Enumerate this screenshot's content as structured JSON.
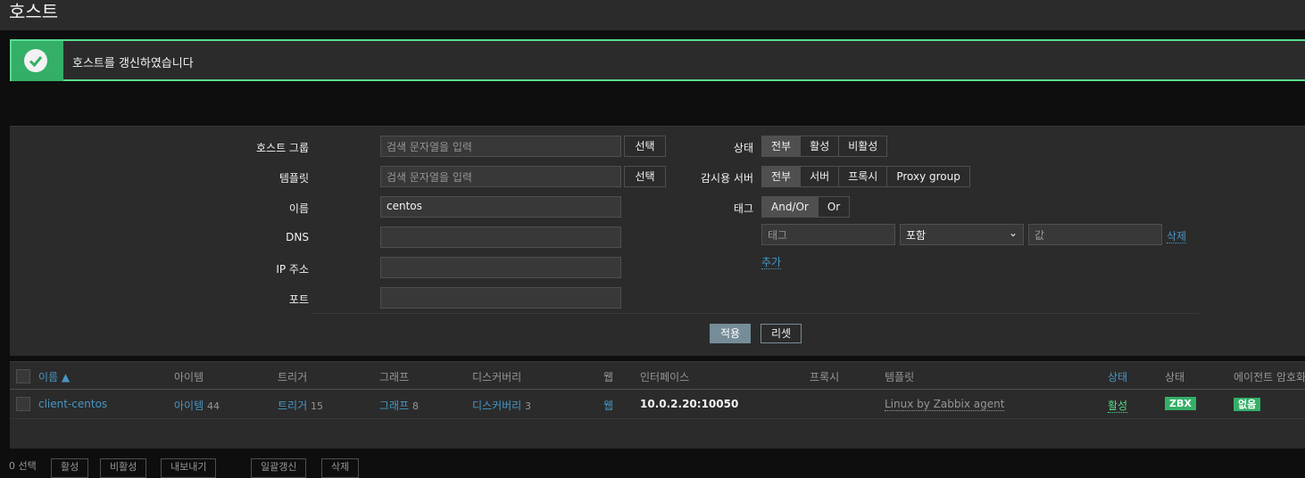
{
  "header": {
    "title": "호스트"
  },
  "message": {
    "text": "호스트를 갱신하였습니다"
  },
  "filter": {
    "host_group_label": "호스트 그룹",
    "host_group_placeholder": "검색 문자열을 입력",
    "template_label": "템플릿",
    "template_placeholder": "검색 문자열을 입력",
    "select_label": "선택",
    "name_label": "이름",
    "name_value": "centos",
    "dns_label": "DNS",
    "ip_label": "IP 주소",
    "port_label": "포트",
    "status_label": "상태",
    "status_options": [
      "전부",
      "활성",
      "비활성"
    ],
    "monitored_by_label": "감시용 서버",
    "monitored_by_options": [
      "전부",
      "서버",
      "프록시",
      "Proxy group"
    ],
    "tags_label": "태그",
    "tags_options": [
      "And/Or",
      "Or"
    ],
    "tag_placeholder": "태그",
    "tag_operator": "포함",
    "tag_value_placeholder": "값",
    "remove_label": "삭제",
    "add_label": "추가",
    "apply_label": "적용",
    "reset_label": "리셋"
  },
  "table": {
    "headers": {
      "name": "이름 ▲",
      "items": "아이템",
      "triggers": "트리거",
      "graphs": "그래프",
      "discovery": "디스커버리",
      "web": "웹",
      "interface": "인터페이스",
      "proxy": "프록시",
      "templates": "템플릿",
      "status_link": "상태",
      "availability": "상태",
      "encryption": "에이전트 암호화"
    },
    "rows": [
      {
        "name": "client-centos",
        "items_label": "아이템",
        "items_count": "44",
        "triggers_label": "트리거",
        "triggers_count": "15",
        "graphs_label": "그래프",
        "graphs_count": "8",
        "discovery_label": "디스커버리",
        "discovery_count": "3",
        "web_label": "웹",
        "interface": "10.0.2.20:10050",
        "template": "Linux by Zabbix agent",
        "status": "활성",
        "availability": "ZBX",
        "encryption": "없음"
      }
    ]
  },
  "bottom": {
    "selected": "0 선택",
    "buttons": [
      "활성",
      "비활성",
      "내보내기",
      "일괄갱신",
      "삭제"
    ]
  },
  "colors": {
    "accent": "#4796c4",
    "success": "#34af67",
    "success_border": "#59db8f",
    "panel": "#2b2b2b"
  }
}
